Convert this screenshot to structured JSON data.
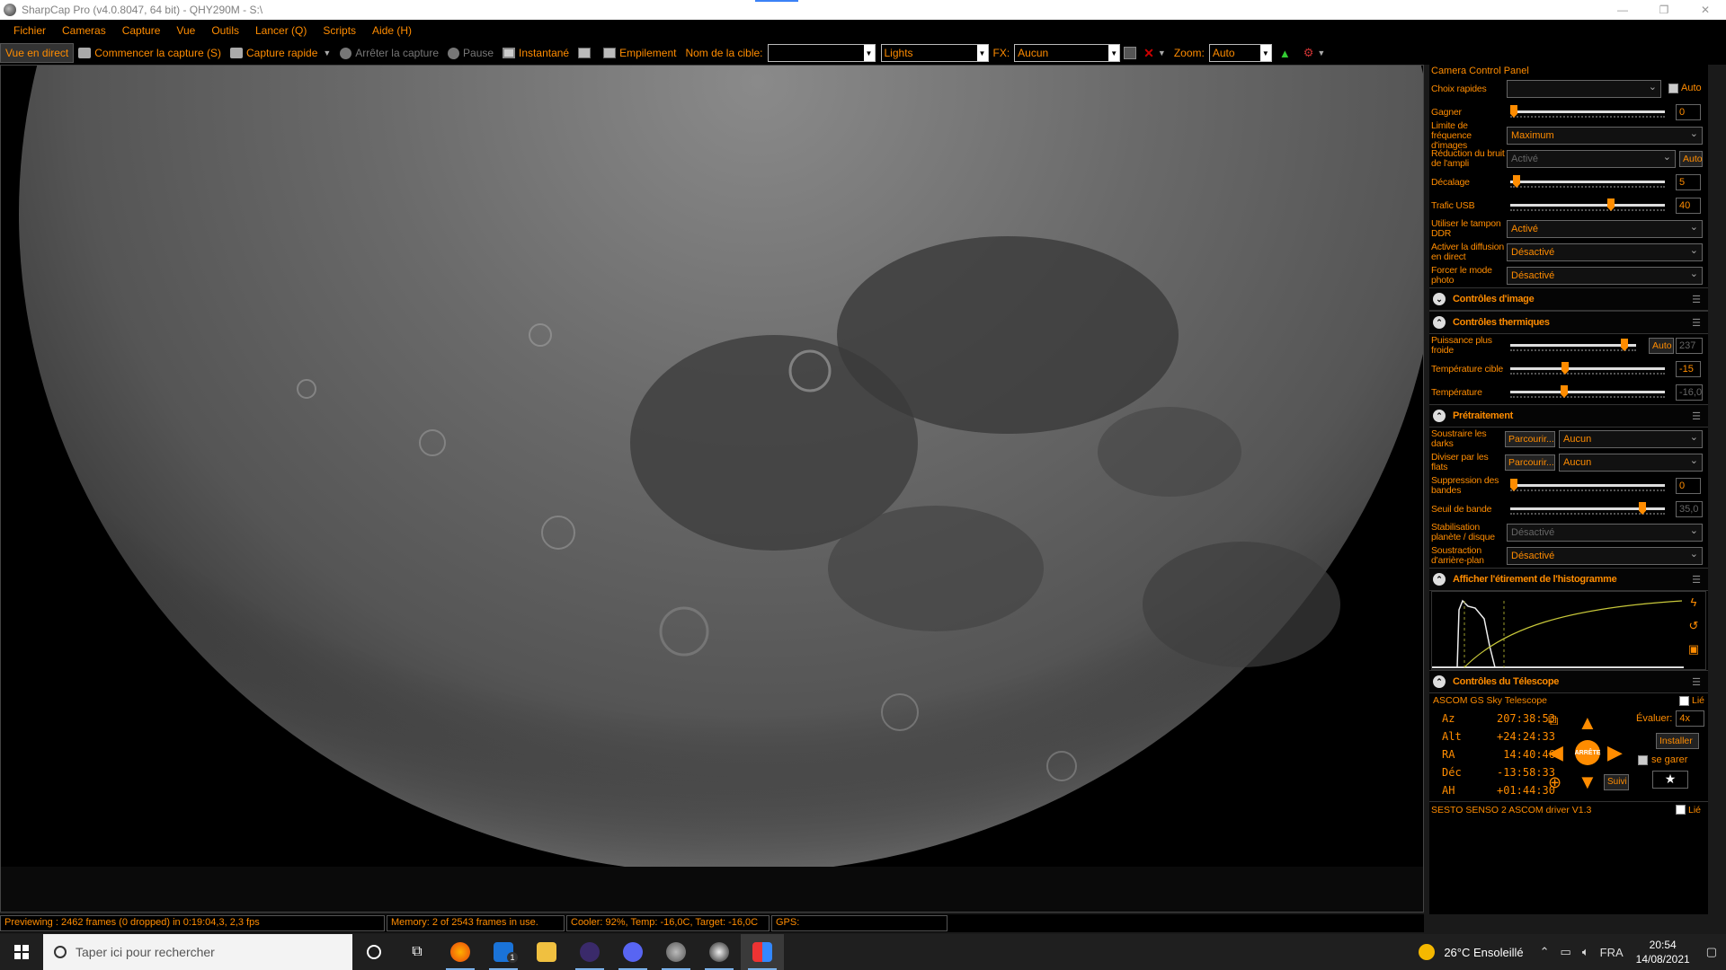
{
  "window": {
    "title": "SharpCap Pro (v4.0.8047, 64 bit) - QHY290M - S:\\",
    "minimize": "—",
    "maximize": "❐",
    "close": "✕"
  },
  "menu": [
    "Fichier",
    "Cameras",
    "Capture",
    "Vue",
    "Outils",
    "Lancer (Q)",
    "Scripts",
    "Aide (H)"
  ],
  "toolbar": {
    "live_view": "Vue en direct",
    "start_capture": "Commencer la capture (S)",
    "quick_capture": "Capture rapide",
    "stop_capture": "Arrêter la capture",
    "pause": "Pause",
    "snapshot": "Instantané",
    "stacking": "Empilement",
    "target_label": "Nom de la cible:",
    "target_value": "",
    "frame_type": "Lights",
    "fx_label": "FX:",
    "fx_value": "Aucun",
    "zoom_label": "Zoom:",
    "zoom_value": "Auto"
  },
  "status": {
    "preview": "Previewing : 2462 frames (0 dropped) in 0:19:04,3, 2,3 fps",
    "memory": "Memory: 2 of 2543 frames in use.",
    "cooler": "Cooler: 92%, Temp: -16,0C, Target: -16,0C",
    "gps": "GPS:"
  },
  "panel": {
    "title": "Camera Control Panel",
    "quick_choices": "Choix rapides",
    "auto": "Auto",
    "gain_label": "Gagner",
    "gain_value": "0",
    "gain_fraction": 0,
    "framerate_label": "Limite de fréquence d'images",
    "framerate_value": "Maximum",
    "ampnoise_label": "Réduction du bruit de l'ampli",
    "ampnoise_value": "Activé",
    "ampnoise_auto": "Auto",
    "offset_label": "Décalage",
    "offset_value": "5",
    "offset_fraction": 0.02,
    "usb_label": "Trafic USB",
    "usb_value": "40",
    "usb_fraction": 0.66,
    "ddr_label": "Utiliser le tampon DDR",
    "ddr_value": "Activé",
    "stream_label": "Activer la diffusion en direct",
    "stream_value": "Désactivé",
    "photo_label": "Forcer le mode photo",
    "photo_value": "Désactivé",
    "image_controls": "Contrôles d'image",
    "thermal_controls": "Contrôles thermiques",
    "cooler_power_label": "Puissance plus froide",
    "cooler_power_auto": "Auto",
    "cooler_power_value": "237",
    "cooler_power_fraction": 0.93,
    "target_temp_label": "Température cible",
    "target_temp_value": "-15",
    "target_temp_fraction": 0.35,
    "temp_label": "Température",
    "temp_value": "-16,0",
    "temp_fraction": 0.34,
    "preprocessing": "Prétraitement",
    "darks_label": "Soustraire les darks",
    "darks_browse": "Parcourir...",
    "darks_value": "Aucun",
    "flats_label": "Diviser par les flats",
    "flats_browse": "Parcourir...",
    "flats_value": "Aucun",
    "banding_label": "Suppression des bandes",
    "banding_value": "0",
    "banding_fraction": 0,
    "band_threshold_label": "Seuil de bande",
    "band_threshold_value": "35,0",
    "band_threshold_fraction": 0.87,
    "stabilization_label": "Stabilisation planète / disque",
    "stabilization_value": "Désactivé",
    "background_label": "Soustraction d'arrière-plan",
    "background_value": "Désactivé",
    "histogram_section": "Afficher l'étirement de l'histogramme",
    "telescope_section": "Contrôles du Télescope",
    "telescope_name": "ASCOM GS Sky Telescope",
    "linked": "Lié",
    "coords": [
      {
        "k": "Az",
        "v": "207:38:53"
      },
      {
        "k": "Alt",
        "v": "+24:24:33"
      },
      {
        "k": "RA",
        "v": "14:40:46"
      },
      {
        "k": "Déc",
        "v": "-13:58:33"
      },
      {
        "k": "AH",
        "v": "+01:44:30"
      }
    ],
    "stop": "ARRÊTE",
    "rate_label": "Évaluer:",
    "rate_value": "4x",
    "install": "Installer",
    "park": "se garer",
    "track": "Suivi",
    "focuser_name": "SESTO SENSO 2 ASCOM driver V1.3"
  },
  "taskbar": {
    "search_placeholder": "Taper ici pour rechercher",
    "weather": "26°C  Ensoleillé",
    "lang": "FRA",
    "time": "20:54",
    "date": "14/08/2021",
    "mail_badge": "1"
  },
  "colors": {
    "accent": "#ff8c00",
    "background": "#000000"
  }
}
